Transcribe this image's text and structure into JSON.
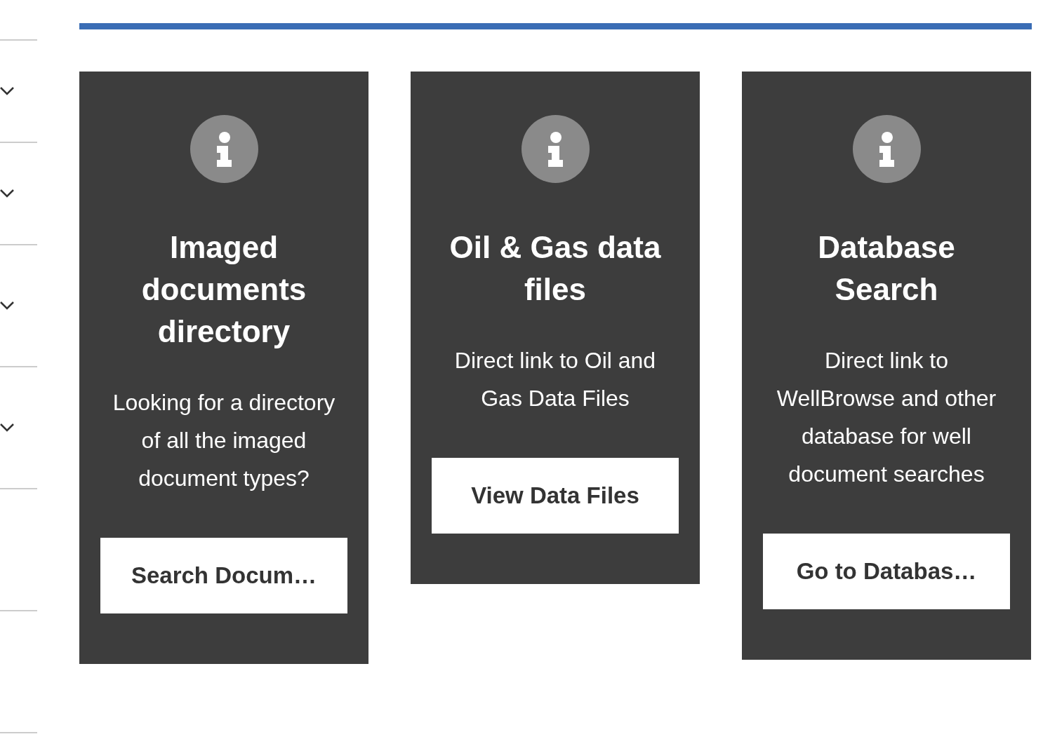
{
  "sidebar": {
    "rows": [
      {
        "kind": "collapsible",
        "expanded": false
      },
      {
        "kind": "collapsible",
        "expanded": false
      },
      {
        "kind": "collapsible",
        "expanded": false
      },
      {
        "kind": "collapsible",
        "expanded": false
      },
      {
        "kind": "plain"
      },
      {
        "kind": "plain"
      }
    ]
  },
  "cards": [
    {
      "title": "Imaged documents directory",
      "description": "Looking for a directory of all the imaged document types?",
      "button": "Search Docum…"
    },
    {
      "title": "Oil & Gas data files",
      "description": "Direct link to Oil and Gas Data Files",
      "button": "View Data Files"
    },
    {
      "title": "Database Search",
      "description": "Direct link to WellBrowse and other database for well document searches",
      "button": "Go to Databas…"
    }
  ]
}
